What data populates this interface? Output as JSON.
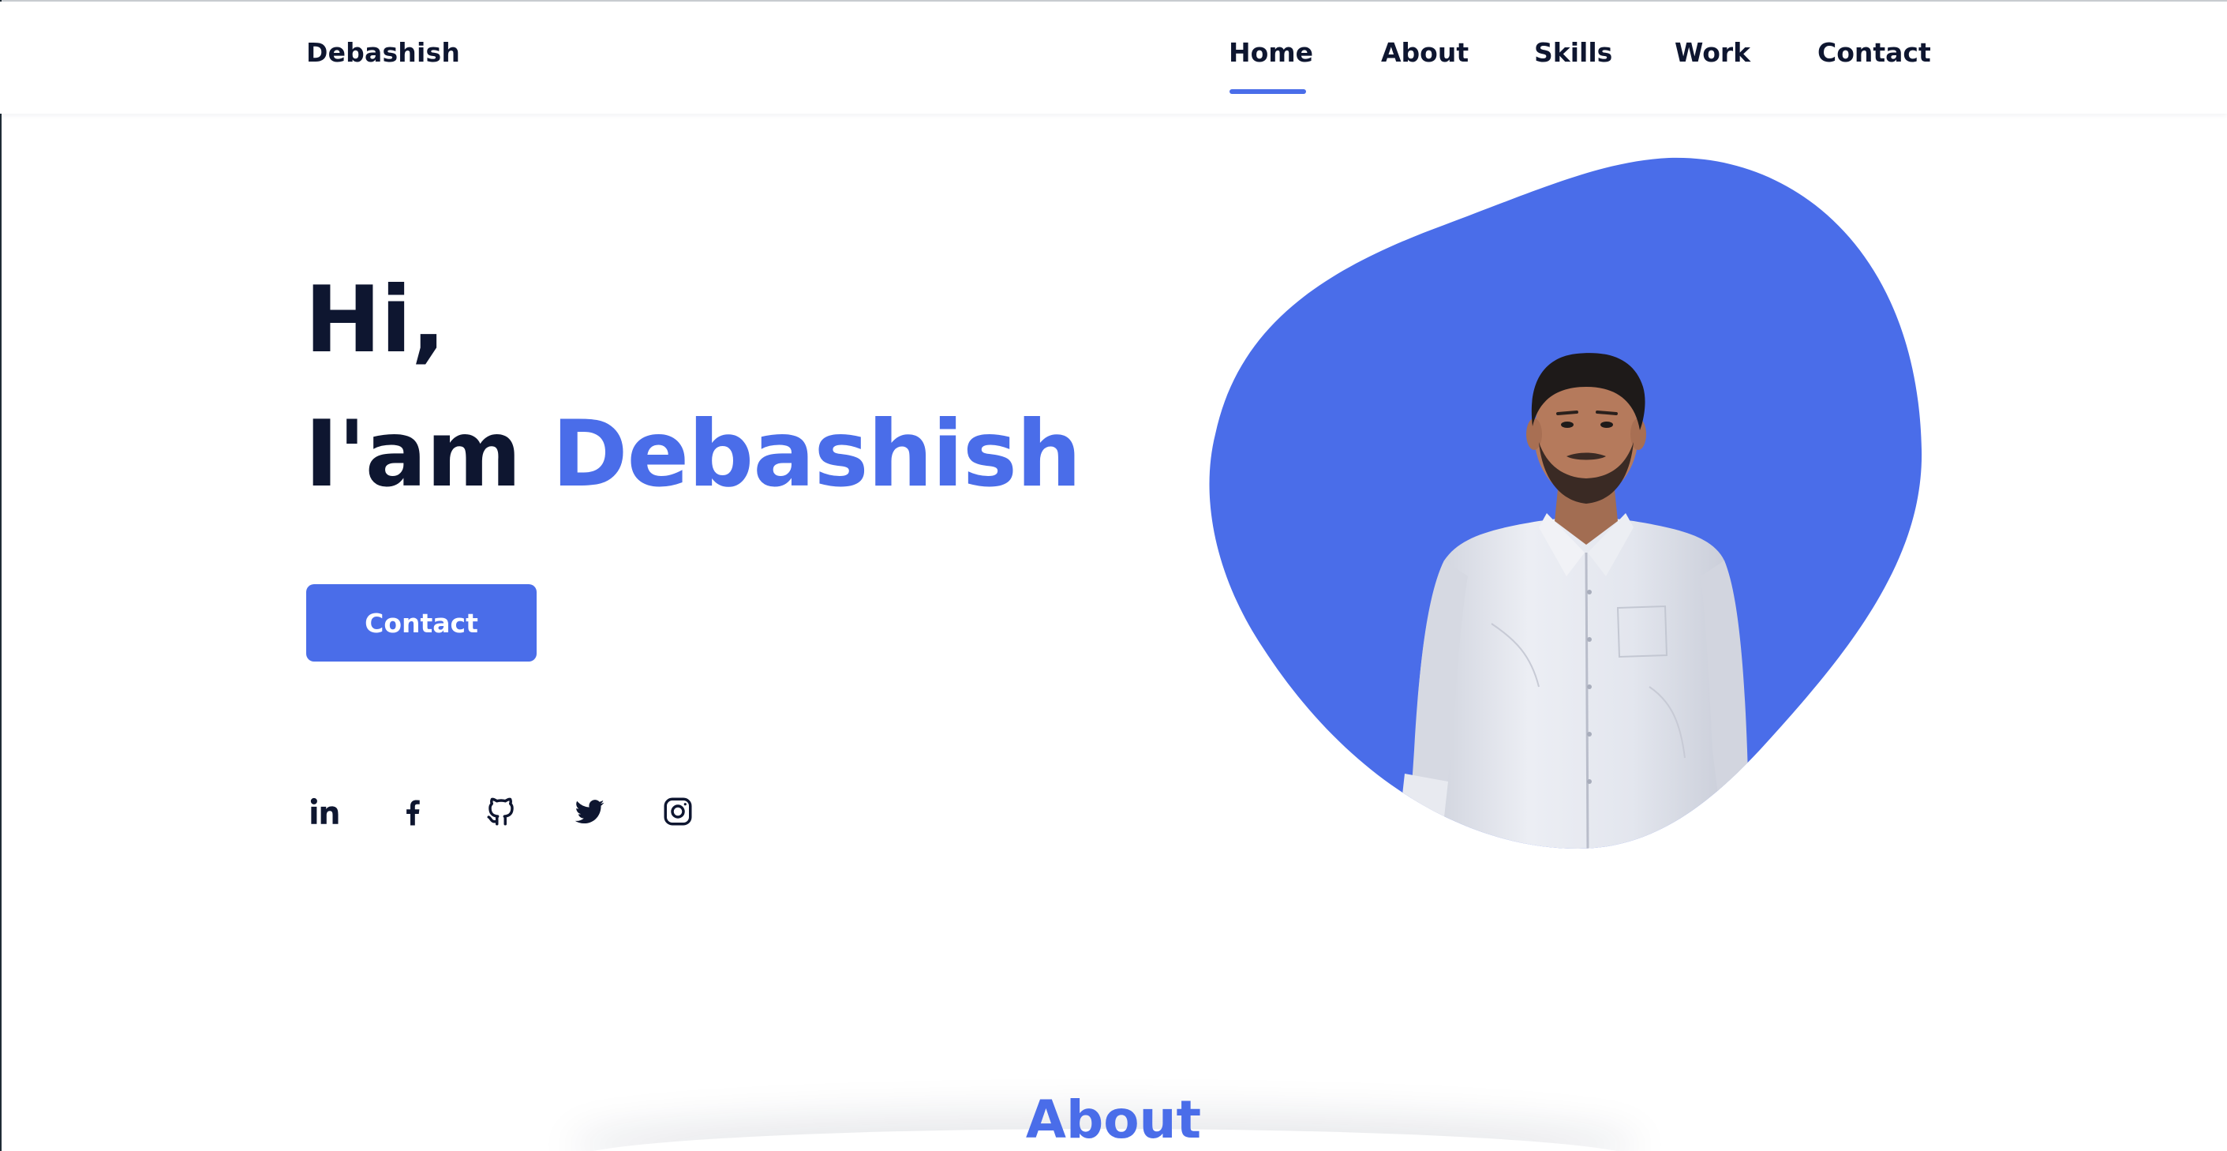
{
  "header": {
    "logo": "Debashish",
    "nav": {
      "home": "Home",
      "about": "About",
      "skills": "Skills",
      "work": "Work",
      "contact": "Contact"
    },
    "active_nav": "Home"
  },
  "hero": {
    "greeting": "Hi,",
    "intro_prefix": "I'am ",
    "name": "Debashish",
    "contact_button": "Contact",
    "portrait": "portrait-photo"
  },
  "social": [
    {
      "name": "linkedin",
      "icon": "linkedin-icon"
    },
    {
      "name": "facebook",
      "icon": "facebook-icon"
    },
    {
      "name": "github",
      "icon": "github-icon"
    },
    {
      "name": "twitter",
      "icon": "twitter-icon"
    },
    {
      "name": "instagram",
      "icon": "instagram-icon"
    }
  ],
  "about": {
    "title": "About"
  },
  "colors": {
    "accent": "#4a6de9",
    "text": "#0e1630",
    "background": "#ffffff"
  }
}
